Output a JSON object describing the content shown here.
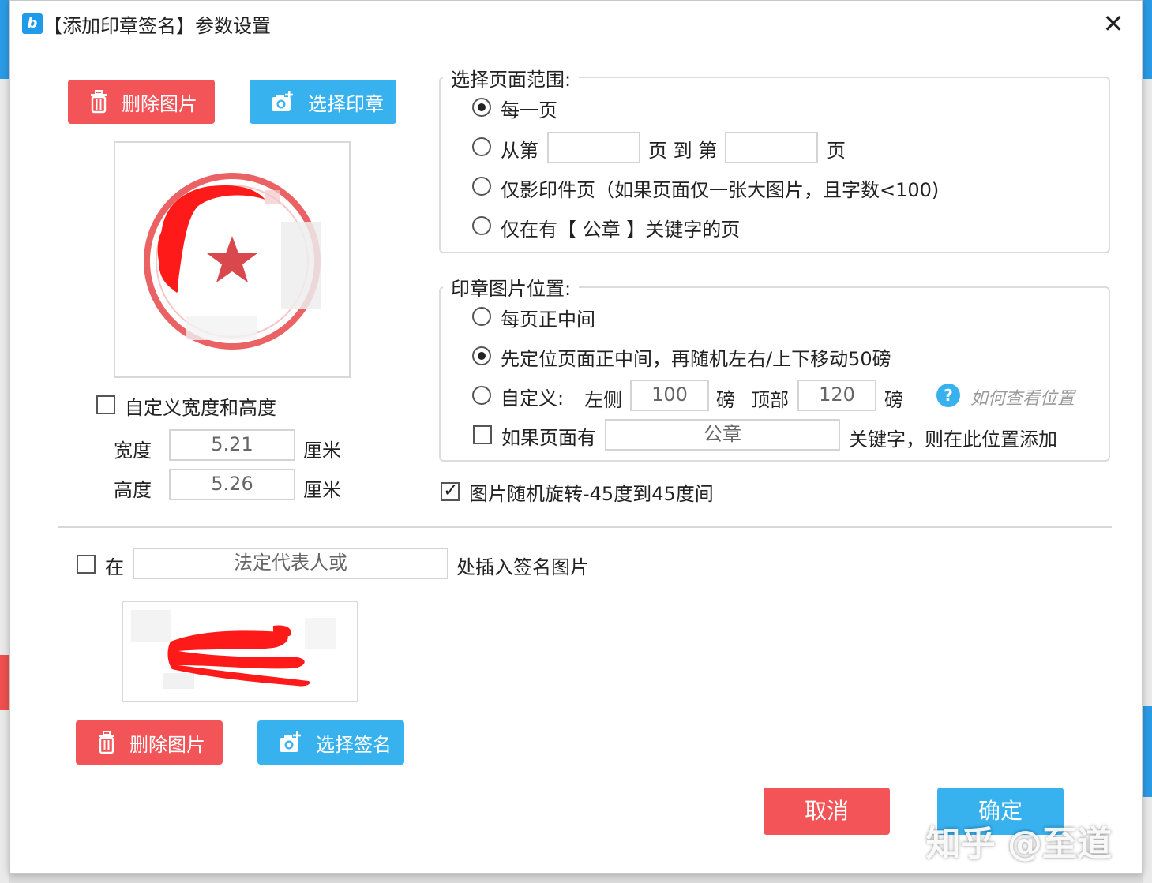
{
  "window": {
    "title": "【添加印章签名】参数设置",
    "close": "✕"
  },
  "stamp": {
    "delete_button": "删除图片",
    "select_button": "选择印章",
    "custom_size_label": "自定义宽度和高度",
    "custom_size_checked": false,
    "width_label": "宽度",
    "width_value": "5.21",
    "height_label": "高度",
    "height_value": "5.26",
    "unit": "厘米"
  },
  "page_range": {
    "title": "选择页面范围:",
    "options": [
      {
        "label": "每一页",
        "checked": true
      },
      {
        "label_prefix": "从第",
        "label_middle": "页 到 第",
        "label_suffix": "页",
        "from_value": "",
        "to_value": "",
        "checked": false
      },
      {
        "label": "仅影印件页（如果页面仅一张大图片，且字数<100)",
        "checked": false
      },
      {
        "label": "仅在有【 公章   】关键字的页",
        "checked": false
      }
    ]
  },
  "position": {
    "title": "印章图片位置:",
    "center_label": "每页正中间",
    "center_checked": false,
    "random_label": "先定位页面正中间，再随机左右/上下移动50磅",
    "random_checked": true,
    "custom_label": "自定义:",
    "custom_checked": false,
    "left_label": "左侧",
    "left_value": "100",
    "top_label": "顶部",
    "top_value": "120",
    "unit": "磅",
    "help_icon": "?",
    "help_link": "如何查看位置",
    "keyword_prefix": "如果页面有",
    "keyword_value": "公章",
    "keyword_suffix": "关键字，则在此位置添加",
    "keyword_checked": false
  },
  "rotate": {
    "label": "图片随机旋转-45度到45度间",
    "checked": true
  },
  "signature": {
    "prefix": "在",
    "checked": false,
    "keyword_value": "法定代表人或",
    "suffix": "处插入签名图片",
    "delete_button": "删除图片",
    "select_button": "选择签名"
  },
  "footer": {
    "cancel": "取消",
    "ok": "确定"
  },
  "watermark": "知乎 @至道",
  "colors": {
    "red": "#f35458",
    "blue": "#38b1ef",
    "stamp_red": "#e8464a"
  }
}
